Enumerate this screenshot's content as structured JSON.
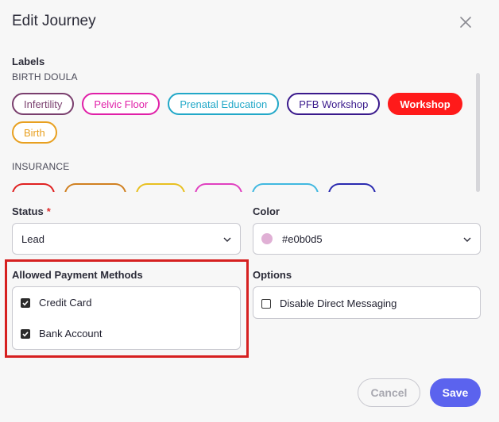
{
  "dialog": {
    "title": "Edit Journey"
  },
  "labels": {
    "heading": "Labels",
    "groups": [
      {
        "name": "BIRTH DOULA",
        "pills": [
          {
            "label": "Infertility",
            "color": "#7a3f6e",
            "filled": false
          },
          {
            "label": "Pelvic Floor",
            "color": "#e020a8",
            "filled": false
          },
          {
            "label": "Prenatal Education",
            "color": "#22a8c8",
            "filled": false
          },
          {
            "label": "PFB Workshop",
            "color": "#3a1a8c",
            "filled": false
          },
          {
            "label": "Workshop",
            "color": "#ff1a1a",
            "filled": true
          },
          {
            "label": "Birth",
            "color": "#e8a020",
            "filled": false
          }
        ]
      },
      {
        "name": "INSURANCE",
        "stubs": [
          "#e02020",
          "#d08020",
          "#e8c020",
          "#e040c0",
          "#40b8e0",
          "#2a2ab0"
        ]
      }
    ]
  },
  "status": {
    "label": "Status",
    "required_mark": "*",
    "value": "Lead"
  },
  "color_field": {
    "label": "Color",
    "value": "#e0b0d5",
    "swatch": "#e0b0d5"
  },
  "payment": {
    "label": "Allowed Payment Methods",
    "options": [
      {
        "label": "Credit Card",
        "checked": true
      },
      {
        "label": "Bank Account",
        "checked": true
      }
    ]
  },
  "options": {
    "label": "Options",
    "items": [
      {
        "label": "Disable Direct Messaging",
        "checked": false
      }
    ]
  },
  "actions": {
    "cancel": "Cancel",
    "save": "Save"
  },
  "colors": {
    "accent": "#5b63ee",
    "highlight": "#d62020"
  }
}
